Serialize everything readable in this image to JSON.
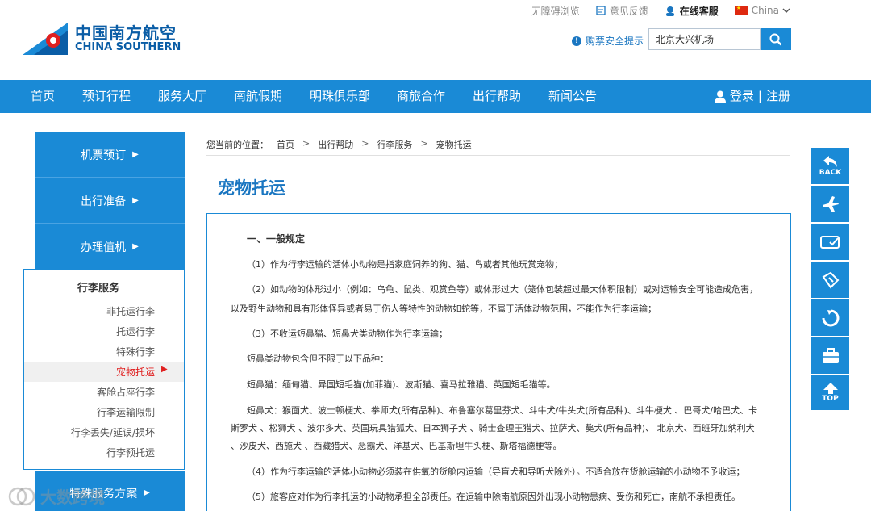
{
  "util": {
    "accessible": "无障碍浏览",
    "feedback": "意见反馈",
    "online": "在线客服",
    "region": "China"
  },
  "logo": {
    "cn": "中国南方航空",
    "en": "CHINA SOUTHERN"
  },
  "tip": "购票安全提示",
  "search": {
    "value": "北京大兴机场"
  },
  "nav": {
    "items": [
      "首页",
      "预订行程",
      "服务大厅",
      "南航假期",
      "明珠俱乐部",
      "商旅合作",
      "出行帮助",
      "新闻公告"
    ],
    "login": "登录",
    "sep": "|",
    "register": "注册"
  },
  "side": {
    "blue": [
      "机票预订",
      "出行准备",
      "办理值机",
      "特殊服务方案"
    ],
    "panel_title": "行李服务",
    "panel_items": [
      "非托运行李",
      "托运行李",
      "特殊行李",
      "宠物托运",
      "客舱占座行李",
      "行李运输限制",
      "行李丢失/延误/损坏",
      "行李预托运"
    ]
  },
  "breadcrumb": {
    "prefix": "您当前的位置：",
    "items": [
      "首页",
      "出行帮助",
      "行李服务",
      "宠物托运"
    ],
    "sep": ">"
  },
  "page_title": "宠物托运",
  "content": {
    "heading": "一、一般规定",
    "p1": "（1）作为行李运输的活体小动物是指家庭饲养的狗、猫、鸟或者其他玩赏宠物；",
    "p2a": "（2）如动物的体形过小（例如：乌龟、鼠类、观赏鱼等）或体形过大（笼体包装超过最大体积限制）或对运输安全可能造成危害，",
    "p2b": "以及野生动物和具有形体怪异或者易于伤人等特性的动物如蛇等，不属于活体动物范围，不能作为行李运输；",
    "p3": "（3）不收运短鼻猫、短鼻犬类动物作为行李运输；",
    "p3b": "短鼻类动物包含但不限于以下品种：",
    "p3c": "短鼻猫：缅甸猫、异国短毛猫(加菲猫)、波斯猫、喜马拉雅猫、英国短毛猫等。",
    "p3d1": "短鼻犬：猴面犬、波士顿梗犬、拳师犬(所有品种)、布鲁塞尔葛里芬犬、斗牛犬/牛头犬(所有品种)、斗牛梗犬 、巴哥犬/哈巴犬、卡",
    "p3d2": "斯罗犬 、松狮犬 、波尔多犬、英国玩具猎狐犬、日本狮子犬 、骑士查理王猎犬、拉萨犬、獒犬(所有品种)、 北京犬、西班牙加纳利犬",
    "p3d3": "、沙皮犬、西施犬 、西藏猎犬、恶霸犬、洋基犬、巴基斯坦牛头梗、斯塔福德梗等。",
    "p4": "（4）作为行李运输的活体小动物必须装在供氧的货舱内运输（导盲犬和导听犬除外）。不适合放在货舱运输的小动物不予收运；",
    "p5": "（5）旅客应对作为行李托运的小动物承担全部责任。在运输中除南航原因外出现小动物患病、受伤和死亡，南航不承担责任。"
  },
  "rbar": {
    "back": "BACK",
    "top": "TOP"
  },
  "watermark": "大数跨境"
}
